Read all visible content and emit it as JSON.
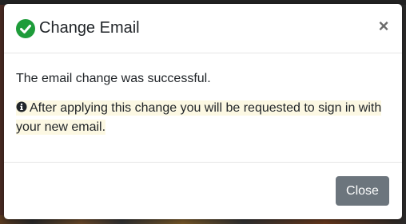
{
  "modal": {
    "title": "Change Email",
    "close_symbol": "×",
    "title_icon": "check-circle-icon",
    "close_icon": "close-icon",
    "success_color": "#1e9c3a"
  },
  "body": {
    "message": "The email change was successful.",
    "notice": "After applying this change you will be requested to sign in with your new email.",
    "notice_icon": "info-circle-icon",
    "notice_highlight_color": "#fcf8e3"
  },
  "footer": {
    "close_label": "Close",
    "close_button_color": "#6c757d"
  }
}
